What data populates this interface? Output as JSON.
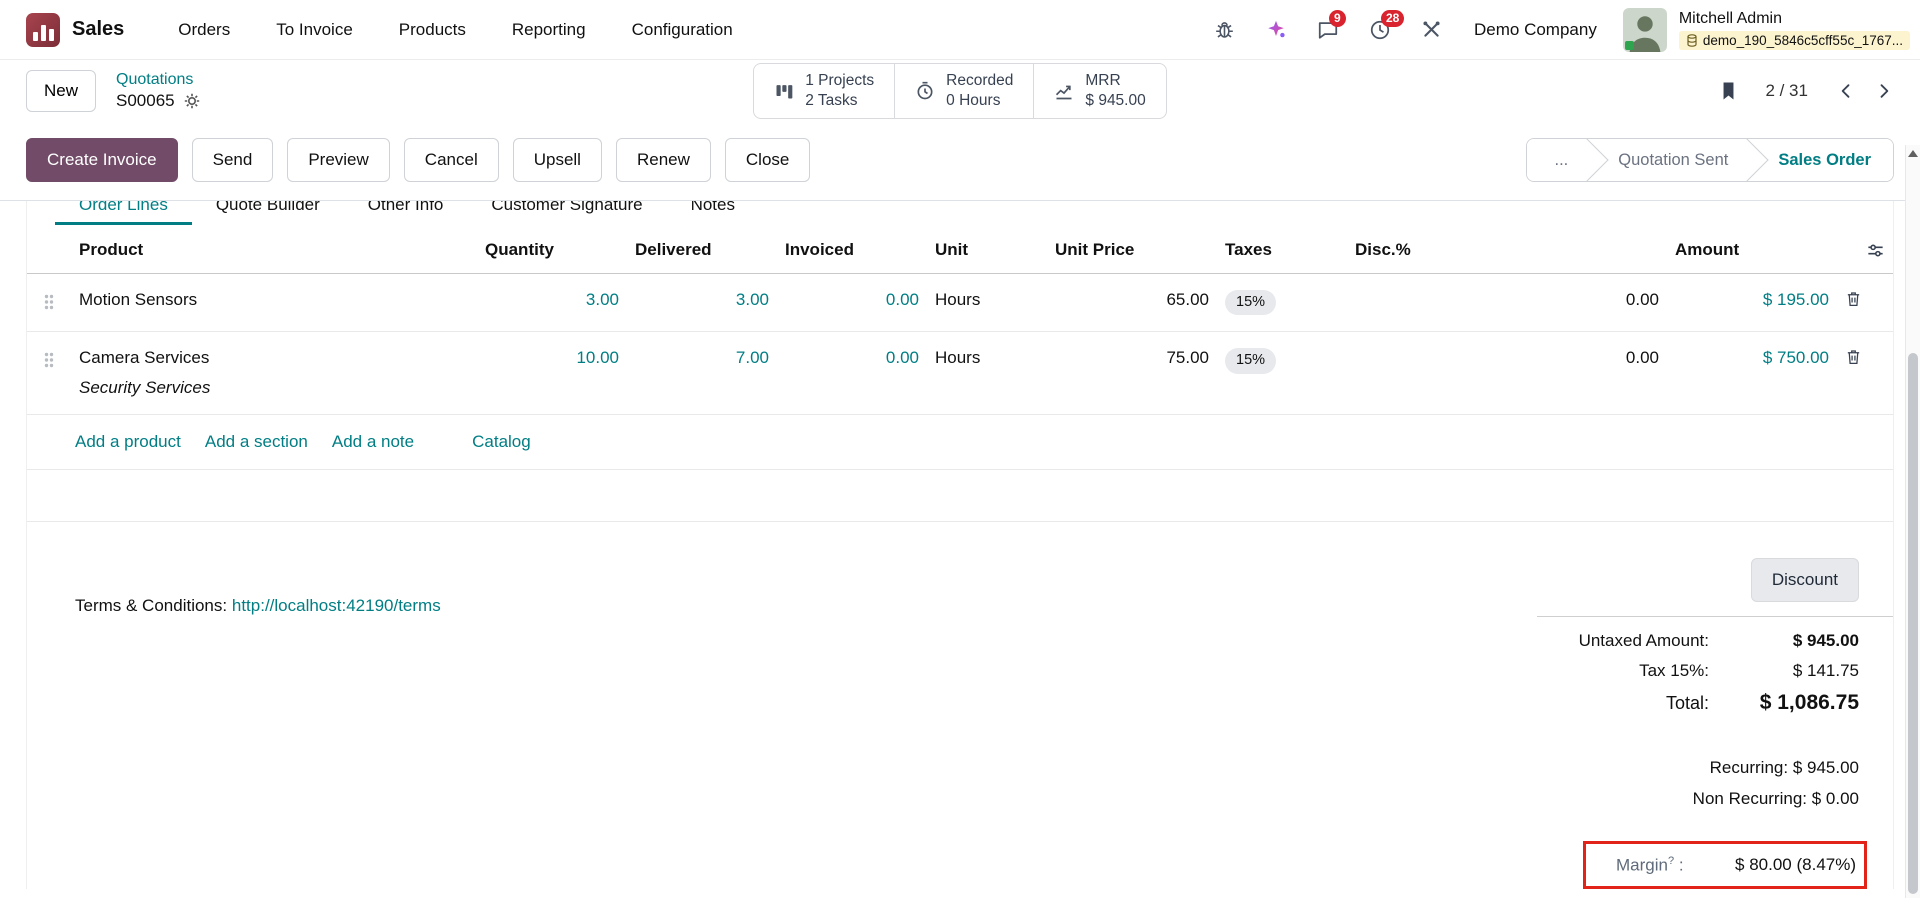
{
  "navbar": {
    "app_name": "Sales",
    "menu_items": [
      "Orders",
      "To Invoice",
      "Products",
      "Reporting",
      "Configuration"
    ],
    "message_badge": "9",
    "activity_badge": "28",
    "company": "Demo Company",
    "user_name": "Mitchell Admin",
    "user_db": "demo_190_5846c5cff55c_1767..."
  },
  "breadcrumb": {
    "new_button": "New",
    "parent": "Quotations",
    "record": "S00065",
    "pager": "2 / 31"
  },
  "stat_buttons": [
    {
      "line1": "1 Projects",
      "line2": "2 Tasks"
    },
    {
      "line1": "Recorded",
      "line2": "0 Hours"
    },
    {
      "line1": "MRR",
      "line2": "$ 945.00"
    }
  ],
  "actions": {
    "primary": "Create Invoice",
    "secondary": [
      "Send",
      "Preview",
      "Cancel",
      "Upsell",
      "Renew",
      "Close"
    ]
  },
  "statusbar": {
    "steps": [
      "...",
      "Quotation Sent",
      "Sales Order"
    ],
    "active": "Sales Order"
  },
  "tabs": [
    "Order Lines",
    "Quote Builder",
    "Other Info",
    "Customer Signature",
    "Notes"
  ],
  "active_tab": "Order Lines",
  "order_lines": {
    "columns": [
      "Product",
      "Quantity",
      "Delivered",
      "Invoiced",
      "Unit",
      "Unit Price",
      "Taxes",
      "Disc.%",
      "Amount"
    ],
    "rows": [
      {
        "product": "Motion Sensors",
        "description": "",
        "quantity": "3.00",
        "delivered": "3.00",
        "invoiced": "0.00",
        "unit": "Hours",
        "unit_price": "65.00",
        "taxes": "15%",
        "disc": "0.00",
        "amount": "$ 195.00"
      },
      {
        "product": "Camera Services",
        "description": "Security Services",
        "quantity": "10.00",
        "delivered": "7.00",
        "invoiced": "0.00",
        "unit": "Hours",
        "unit_price": "75.00",
        "taxes": "15%",
        "disc": "0.00",
        "amount": "$ 750.00"
      }
    ],
    "footer_links": [
      "Add a product",
      "Add a section",
      "Add a note",
      "Catalog"
    ]
  },
  "terms": {
    "label": "Terms & Conditions:",
    "link": "http://localhost:42190/terms"
  },
  "totals": {
    "discount_button": "Discount",
    "untaxed_label": "Untaxed Amount:",
    "untaxed_value": "$ 945.00",
    "tax_label": "Tax 15%:",
    "tax_value": "$ 141.75",
    "total_label": "Total:",
    "total_value": "$ 1,086.75",
    "recurring_label": "Recurring:",
    "recurring_value": "$ 945.00",
    "non_recurring_label": "Non Recurring:",
    "non_recurring_value": "$ 0.00",
    "margin_label": "Margin",
    "margin_help": "?",
    "margin_colon": ":",
    "margin_value": "$ 80.00 (8.47%)"
  },
  "icons": [
    "apps-icon",
    "bug-icon",
    "ai-icon",
    "messages-icon",
    "activities-icon",
    "tools-icon",
    "database-icon",
    "gear-icon",
    "bookmark-icon",
    "chevron-left-icon",
    "chevron-right-icon",
    "projects-icon",
    "timer-icon",
    "mrr-chart-icon",
    "drag-handle-icon",
    "trash-icon",
    "optional-columns-icon",
    "scroll-up-icon"
  ],
  "colors": {
    "brand": "#714B67",
    "link": "#017E84",
    "badge_red": "#D9232E",
    "tax_badge_bg": "#E7E9ED",
    "annotation_red": "#E2231A",
    "db_strip_bg": "#FCF3CF"
  }
}
